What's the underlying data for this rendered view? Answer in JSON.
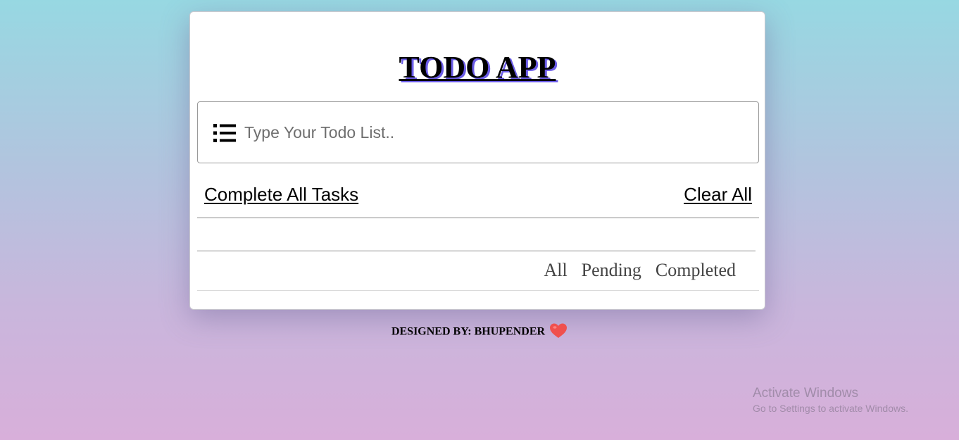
{
  "app": {
    "title": "TODO APP"
  },
  "input": {
    "placeholder": "Type Your Todo List..",
    "value": "",
    "icon": "list-icon"
  },
  "actions": {
    "complete_all_label": "Complete All Tasks",
    "clear_all_label": "Clear All"
  },
  "filters": [
    {
      "label": "All"
    },
    {
      "label": "Pending"
    },
    {
      "label": "Completed"
    }
  ],
  "footer": {
    "text": "DESIGNED BY: BHUPENDER",
    "icon": "heart-icon"
  },
  "watermark": {
    "title": "Activate Windows",
    "subtitle": "Go to Settings to activate Windows."
  },
  "colors": {
    "title_shadow": "#6b5ce7",
    "heart": "#f0504d"
  }
}
